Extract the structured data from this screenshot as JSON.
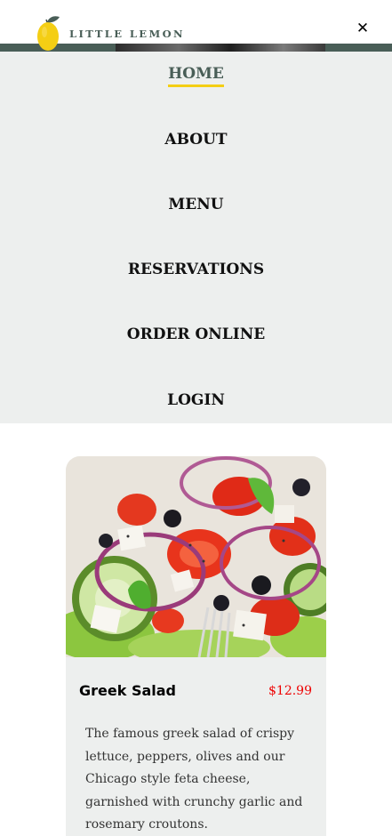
{
  "header": {
    "logo_text": "LITTLE LEMON",
    "logo_icon": "lemon-icon",
    "close_icon": "close-icon",
    "close_glyph": "✕"
  },
  "nav": {
    "items": [
      {
        "label": "HOME",
        "active": true
      },
      {
        "label": "ABOUT",
        "active": false
      },
      {
        "label": "MENU",
        "active": false
      },
      {
        "label": "RESERVATIONS",
        "active": false
      },
      {
        "label": "ORDER ONLINE",
        "active": false
      },
      {
        "label": "LOGIN",
        "active": false
      }
    ]
  },
  "special": {
    "title": "Greek Salad",
    "price": "$12.99",
    "description": "The famous greek salad of crispy lettuce, peppers, olives and our Chicago style feta cheese, garnished with crunchy garlic and rosemary croutons."
  },
  "colors": {
    "primary_green": "#495e57",
    "primary_yellow": "#f4ce14",
    "nav_background": "#edefee",
    "price_red": "#ee0000"
  }
}
